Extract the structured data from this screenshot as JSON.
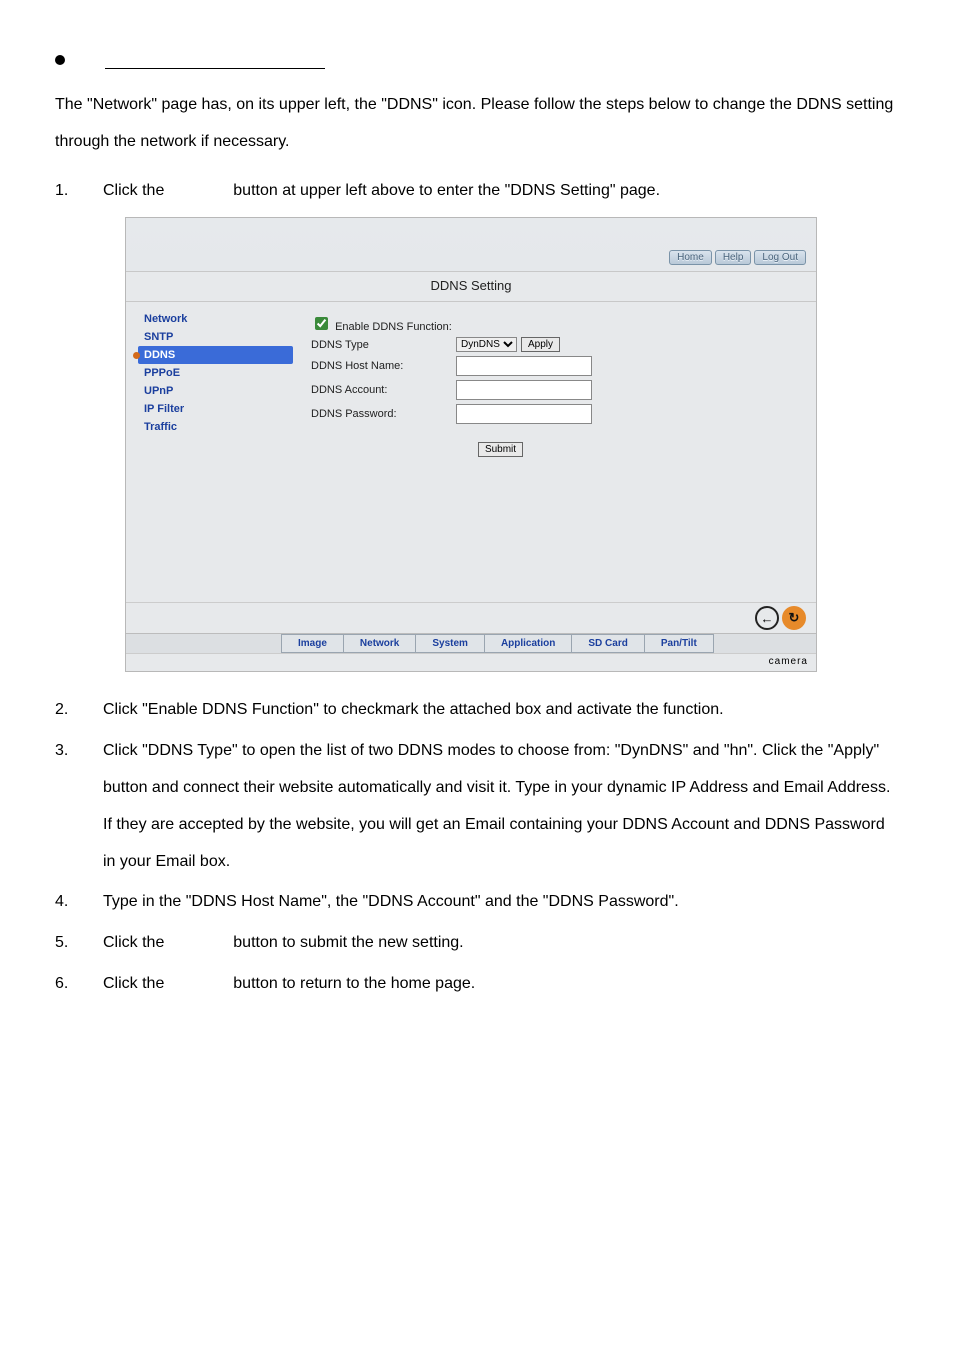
{
  "intro_paragraph": "The \"Network\" page has, on its upper left, the \"DDNS\" icon. Please follow the steps below to change the DDNS setting through the network if necessary.",
  "steps": {
    "s1a": "Click the",
    "s1b": "button at upper left above to enter the \"DDNS Setting\" page.",
    "s2": "Click \"Enable DDNS Function\" to checkmark the attached box and activate the function.",
    "s3": "Click \"DDNS Type\" to open the list of two DDNS modes to choose from: \"DynDNS\" and \"hn\". Click the \"Apply\" button and connect their website automatically and visit it. Type in your dynamic IP Address and Email Address. If they are accepted by the website, you will get an Email containing your DDNS Account and DDNS Password in your Email box.",
    "s4": "Type in the \"DDNS Host Name\", the \"DDNS Account\" and the \"DDNS Password\".",
    "s5a": "Click the",
    "s5b": "button to submit the new setting.",
    "s6a": "Click the",
    "s6b": "button to return to the home page."
  },
  "screenshot": {
    "topbuttons": {
      "home": "Home",
      "help": "Help",
      "logout": "Log Out"
    },
    "title": "DDNS Setting",
    "sidebar": [
      "Network",
      "SNTP",
      "DDNS",
      "PPPoE",
      "UPnP",
      "IP Filter",
      "Traffic"
    ],
    "form": {
      "enable_label": "Enable DDNS Function:",
      "type_label": "DDNS Type",
      "type_selected": "DynDNS",
      "apply": "Apply",
      "host_label": "DDNS Host Name:",
      "account_label": "DDNS Account:",
      "password_label": "DDNS Password:",
      "submit": "Submit"
    },
    "tabs": [
      "Image",
      "Network",
      "System",
      "Application",
      "SD Card",
      "Pan/Tilt"
    ],
    "corner": "camera",
    "back_glyph": "←",
    "refresh_glyph": "↻"
  }
}
